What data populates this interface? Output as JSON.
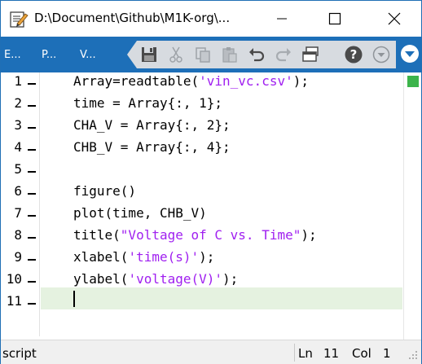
{
  "window": {
    "title": "D:\\Document\\Github\\M1K-org\\..."
  },
  "toolbar": {
    "tabs": [
      {
        "label": "E..."
      },
      {
        "label": "P..."
      },
      {
        "label": "V..."
      }
    ],
    "tools": [
      {
        "icon": "save-icon",
        "enabled": true
      },
      {
        "icon": "cut-icon",
        "enabled": false
      },
      {
        "icon": "copy-icon",
        "enabled": false
      },
      {
        "icon": "paste-icon",
        "enabled": false
      },
      {
        "icon": "undo-icon",
        "enabled": true
      },
      {
        "icon": "redo-icon",
        "enabled": false
      },
      {
        "icon": "print-icon",
        "enabled": true
      },
      {
        "icon": "help-icon",
        "enabled": true
      },
      {
        "icon": "options-icon",
        "enabled": true
      }
    ]
  },
  "editor": {
    "lines": [
      {
        "num": "1",
        "parts": [
          {
            "t": "Array=readtable("
          },
          {
            "t": "'vin_vc.csv'",
            "s": true
          },
          {
            "t": ");"
          }
        ]
      },
      {
        "num": "2",
        "parts": [
          {
            "t": "time = Array{:, 1};"
          }
        ]
      },
      {
        "num": "3",
        "parts": [
          {
            "t": "CHA_V = Array{:, 2};"
          }
        ]
      },
      {
        "num": "4",
        "parts": [
          {
            "t": "CHB_V = Array{:, 4};"
          }
        ]
      },
      {
        "num": "5",
        "parts": [
          {
            "t": ""
          }
        ]
      },
      {
        "num": "6",
        "parts": [
          {
            "t": "figure()"
          }
        ]
      },
      {
        "num": "7",
        "parts": [
          {
            "t": "plot(time, CHB_V)"
          }
        ]
      },
      {
        "num": "8",
        "parts": [
          {
            "t": "title("
          },
          {
            "t": "\"Voltage of C vs. Time\"",
            "s": true
          },
          {
            "t": ");"
          }
        ]
      },
      {
        "num": "9",
        "parts": [
          {
            "t": "xlabel("
          },
          {
            "t": "'time(s)'",
            "s": true
          },
          {
            "t": ");"
          }
        ]
      },
      {
        "num": "10",
        "parts": [
          {
            "t": "ylabel("
          },
          {
            "t": "'voltage(V)'",
            "s": true
          },
          {
            "t": ");"
          }
        ]
      },
      {
        "num": "11",
        "parts": [
          {
            "t": ""
          }
        ]
      }
    ],
    "string_color": "#a020f0",
    "current_line_color": "#e5f2e0",
    "status_indicator_color": "#3cb44b"
  },
  "statusbar": {
    "mode": "script",
    "ln_label": "Ln",
    "ln_value": "11",
    "col_label": "Col",
    "col_value": "1"
  },
  "colors": {
    "band": "#1d6fb8"
  }
}
